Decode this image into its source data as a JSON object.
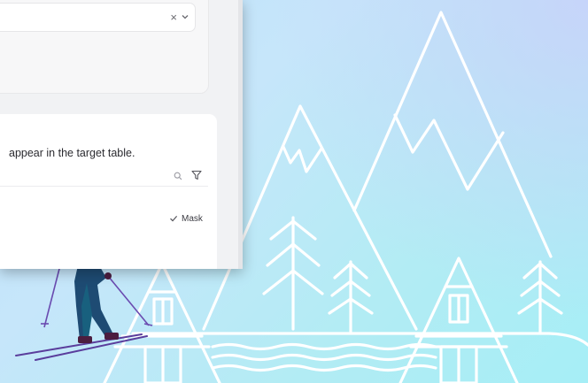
{
  "panel": {
    "select": {
      "clear_icon": "close-icon",
      "chevron_icon": "chevron-down-icon"
    },
    "description": "appear in the target table.",
    "toolbar": {
      "search_icon": "search-icon",
      "filter_icon": "filter-icon"
    },
    "row": {
      "status_icon": "check-icon",
      "status_label": "Mask"
    }
  },
  "background": {
    "illustration": "mountain-cabin-skier-scene",
    "line_color": "#ffffff"
  }
}
